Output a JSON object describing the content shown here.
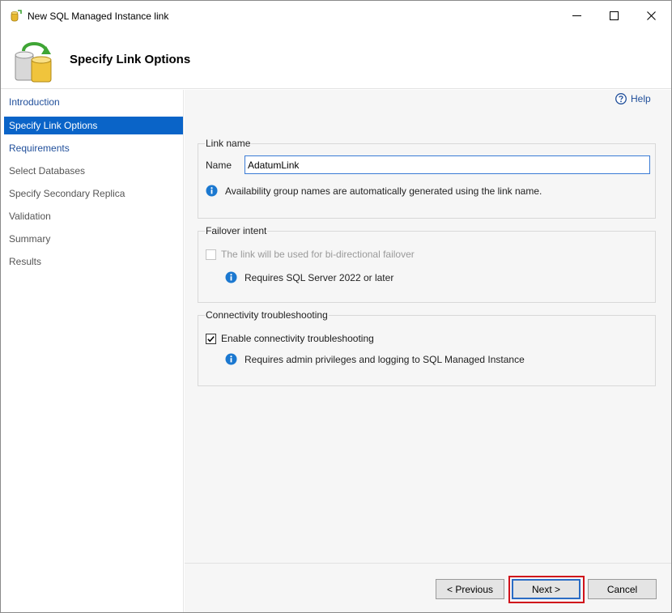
{
  "window": {
    "title": "New SQL Managed Instance link",
    "controls": [
      "minimize-icon",
      "maximize-icon",
      "close-icon"
    ]
  },
  "header": {
    "page_title": "Specify Link Options",
    "icon": "database-sync-icon"
  },
  "nav": {
    "items": [
      {
        "label": "Introduction",
        "state": "link"
      },
      {
        "label": "Specify Link Options",
        "state": "active"
      },
      {
        "label": "Requirements",
        "state": "link"
      },
      {
        "label": "Select Databases",
        "state": "plain"
      },
      {
        "label": "Specify Secondary Replica",
        "state": "plain"
      },
      {
        "label": "Validation",
        "state": "plain"
      },
      {
        "label": "Summary",
        "state": "plain"
      },
      {
        "label": "Results",
        "state": "plain"
      }
    ]
  },
  "help": {
    "label": "Help",
    "icon": "help-icon"
  },
  "link_name_group": {
    "title": "Link name",
    "name_label": "Name",
    "name_value": "AdatumLink",
    "info": "Availability group names are automatically generated using the link name."
  },
  "failover_group": {
    "title": "Failover intent",
    "checkbox_label": "The link will be used for bi-directional failover",
    "checked": false,
    "disabled": true,
    "info": "Requires SQL Server 2022 or later"
  },
  "connectivity_group": {
    "title": "Connectivity troubleshooting",
    "checkbox_label": "Enable connectivity troubleshooting",
    "checked": true,
    "info": "Requires admin privileges and logging to SQL Managed Instance"
  },
  "footer": {
    "previous_label": "< Previous",
    "next_label": "Next >",
    "cancel_label": "Cancel"
  },
  "colors": {
    "accent": "#0a64c8",
    "link": "#1f4e9a",
    "highlight": "#d0121b",
    "info": "#1b78d0"
  }
}
